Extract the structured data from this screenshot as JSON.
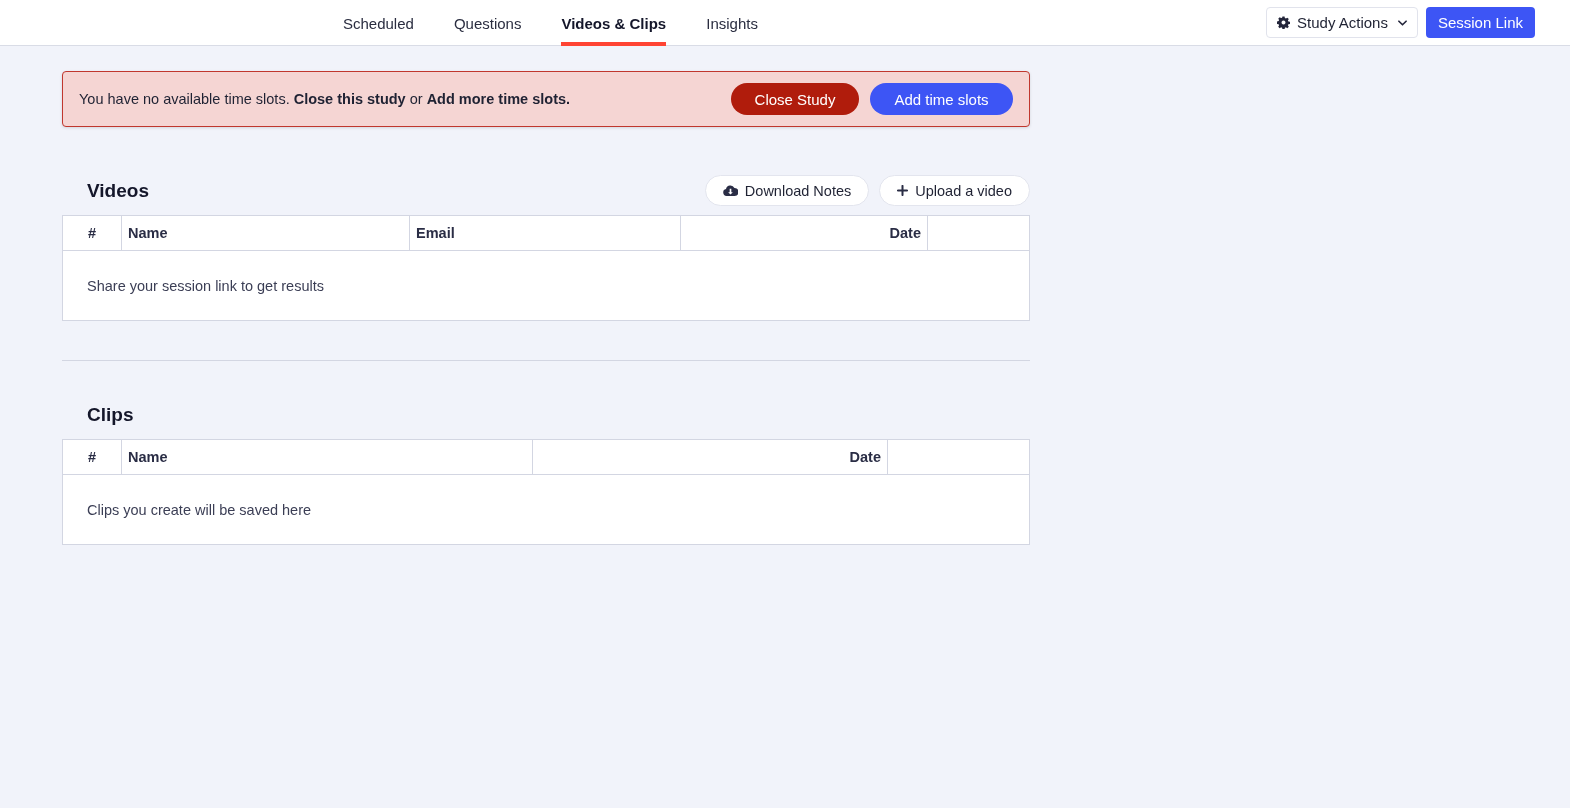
{
  "nav": {
    "tabs": [
      {
        "label": "Scheduled",
        "selected": false
      },
      {
        "label": "Questions",
        "selected": false
      },
      {
        "label": "Videos & Clips",
        "selected": true
      },
      {
        "label": "Insights",
        "selected": false
      }
    ],
    "actions": [
      {
        "label": "Study Actions",
        "kind": "menu"
      },
      {
        "label": "Session Link",
        "kind": "primary"
      }
    ]
  },
  "alert": {
    "message": "You have no available time slots. **Close this study** or **Add more time slots.**",
    "buttons": [
      {
        "label": "Close Study",
        "kind": "danger"
      },
      {
        "label": "Add time slots",
        "kind": "primary"
      }
    ]
  },
  "sections": [
    {
      "title": "Videos",
      "buttons": [
        {
          "label": "Download Notes",
          "kind": "download"
        },
        {
          "label": "Upload a video",
          "kind": "upload"
        }
      ],
      "columns": [
        "#",
        "Name",
        "Email",
        "Date"
      ],
      "empty_message": "Share your session link to get results"
    },
    {
      "title": "Clips",
      "columns": [
        "#",
        "Name",
        "Date"
      ],
      "empty_message": "Clips you create will be saved here"
    }
  ]
}
